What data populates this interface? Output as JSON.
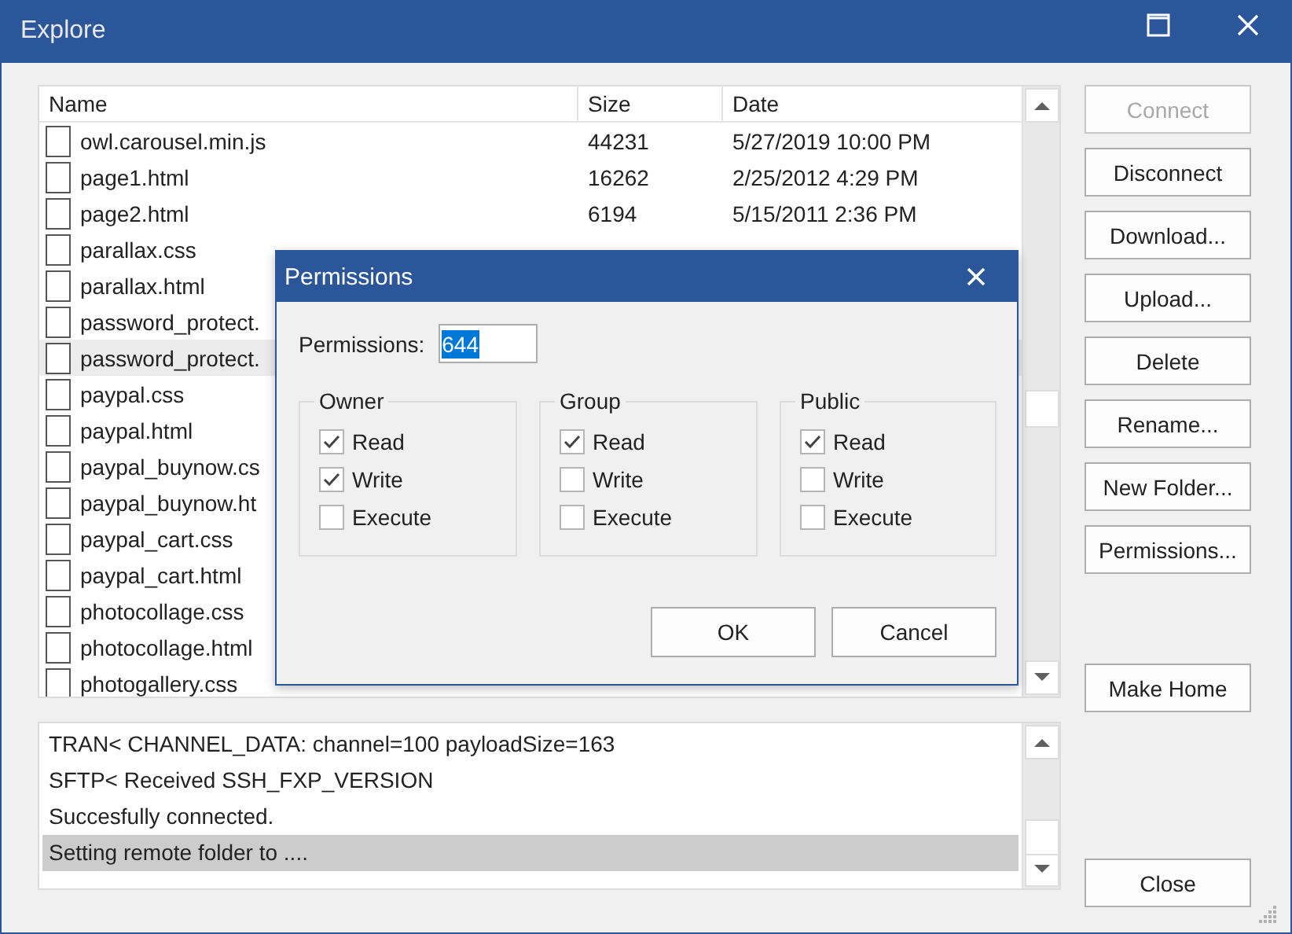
{
  "window": {
    "title": "Explore"
  },
  "file_list": {
    "columns": [
      "Name",
      "Size",
      "Date"
    ],
    "rows": [
      {
        "name": "owl.carousel.min.js",
        "size": "44231",
        "date": "5/27/2019 10:00 PM",
        "selected": false
      },
      {
        "name": "page1.html",
        "size": "16262",
        "date": "2/25/2012 4:29 PM",
        "selected": false
      },
      {
        "name": "page2.html",
        "size": "6194",
        "date": "5/15/2011 2:36 PM",
        "selected": false
      },
      {
        "name": "parallax.css",
        "selected": false
      },
      {
        "name": "parallax.html",
        "selected": false
      },
      {
        "name": "password_protect.",
        "selected": false
      },
      {
        "name": "password_protect.",
        "selected": true
      },
      {
        "name": "paypal.css",
        "selected": false
      },
      {
        "name": "paypal.html",
        "selected": false
      },
      {
        "name": "paypal_buynow.cs",
        "selected": false
      },
      {
        "name": "paypal_buynow.ht",
        "selected": false
      },
      {
        "name": "paypal_cart.css",
        "selected": false
      },
      {
        "name": "paypal_cart.html",
        "selected": false
      },
      {
        "name": "photocollage.css",
        "selected": false
      },
      {
        "name": "photocollage.html",
        "selected": false
      },
      {
        "name": "photogallery.css",
        "selected": false
      }
    ]
  },
  "log": [
    {
      "text": "TRAN< CHANNEL_DATA: channel=100 payloadSize=163",
      "selected": false
    },
    {
      "text": "SFTP< Received SSH_FXP_VERSION",
      "selected": false
    },
    {
      "text": "Succesfully connected.",
      "selected": false
    },
    {
      "text": "Setting remote folder to ....",
      "selected": true
    }
  ],
  "buttons": [
    {
      "label": "Connect",
      "disabled": true
    },
    {
      "label": "Disconnect",
      "disabled": false
    },
    {
      "label": "Download...",
      "disabled": false
    },
    {
      "label": "Upload...",
      "disabled": false
    },
    {
      "label": "Delete",
      "disabled": false
    },
    {
      "label": "Rename...",
      "disabled": false
    },
    {
      "label": "New Folder...",
      "disabled": false
    },
    {
      "label": "Permissions...",
      "disabled": false
    },
    {
      "label": "Make Home",
      "disabled": false
    },
    {
      "label": "Close",
      "disabled": false
    }
  ],
  "dialog": {
    "title": "Permissions",
    "field_label": "Permissions:",
    "value": "644",
    "groups": [
      {
        "label": "Owner",
        "options": [
          {
            "label": "Read",
            "checked": true
          },
          {
            "label": "Write",
            "checked": true
          },
          {
            "label": "Execute",
            "checked": false
          }
        ]
      },
      {
        "label": "Group",
        "options": [
          {
            "label": "Read",
            "checked": true
          },
          {
            "label": "Write",
            "checked": false
          },
          {
            "label": "Execute",
            "checked": false
          }
        ]
      },
      {
        "label": "Public",
        "options": [
          {
            "label": "Read",
            "checked": true
          },
          {
            "label": "Write",
            "checked": false
          },
          {
            "label": "Execute",
            "checked": false
          }
        ]
      }
    ],
    "buttons": [
      "OK",
      "Cancel"
    ]
  }
}
